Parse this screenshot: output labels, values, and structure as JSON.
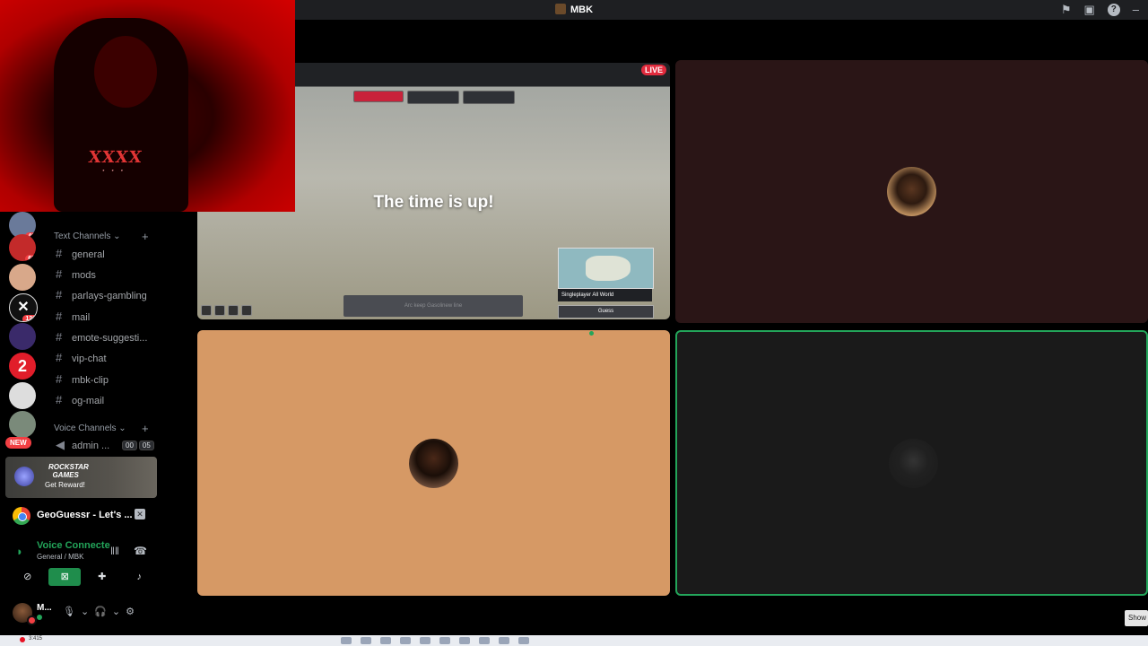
{
  "window": {
    "title": "MBK"
  },
  "servers": [
    {
      "badge": "48"
    },
    {
      "badge": "63"
    },
    {
      "badge": ""
    },
    {
      "badge": "120"
    },
    {
      "badge": ""
    },
    {
      "label": "2"
    },
    {
      "badge": ""
    },
    {
      "badge": ""
    }
  ],
  "new_badge": "NEW",
  "categories": {
    "text": "Text Channels",
    "voice": "Voice Channels"
  },
  "text_channels": [
    "general",
    "mods",
    "parlays-gambling",
    "mail",
    "emote-suggesti...",
    "vip-chat",
    "mbk-clip",
    "og-mail"
  ],
  "voice_channel": {
    "name": "admin ...",
    "count_a": "00",
    "count_b": "05"
  },
  "promo": {
    "brand_line1": "ROCKSTAR",
    "brand_line2": "GAMES",
    "cta": "Get Reward!"
  },
  "activity": {
    "label": "GeoGuessr - Let's ..."
  },
  "voice": {
    "title": "Voice Connecte",
    "subtitle": "General / MBK"
  },
  "user": {
    "name": "M..."
  },
  "stream": {
    "live_label": "LIVE",
    "headline": "The time is up!",
    "map_label": "Singleplayer  All World",
    "guess_label": "Guess",
    "chat_placeholder": "Arc keep Gasolinew line"
  },
  "show_button": "Show",
  "taskbar": {
    "clock": "3:415"
  },
  "colors": {
    "live": "#e12b3d",
    "speaking": "#23a55a",
    "tile_orange": "#d69965",
    "tile_maroon": "#2a1516"
  }
}
